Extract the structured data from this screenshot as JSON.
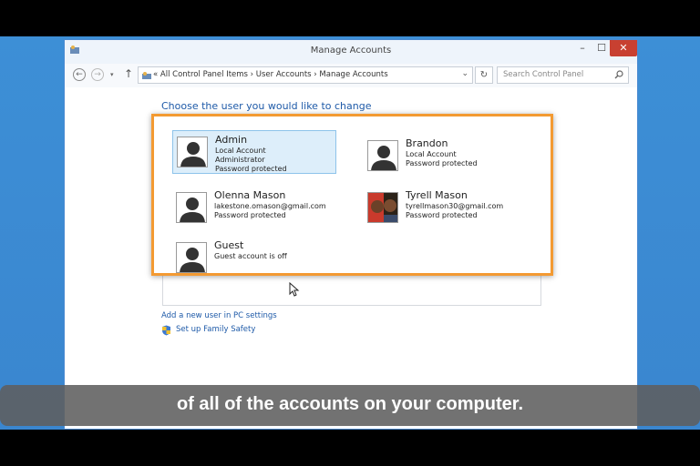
{
  "window": {
    "title": "Manage Accounts",
    "min_label": "–",
    "max_label": "☐",
    "close_label": "✕"
  },
  "nav": {
    "back_label": "←",
    "forward_label": "→",
    "recent_label": "▾",
    "up_label": "↑",
    "address": "« All Control Panel Items  ›  User Accounts  ›  Manage Accounts",
    "address_dropdown_label": "⌄",
    "refresh_label": "↻",
    "search_placeholder": "Search Control Panel"
  },
  "main": {
    "heading": "Choose the user you would like to change",
    "accounts": [
      {
        "name": "Admin",
        "lines": [
          "Local Account",
          "Administrator",
          "Password protected"
        ],
        "selected": true,
        "photo": false
      },
      {
        "name": "Brandon",
        "lines": [
          "Local Account",
          "Password protected"
        ],
        "selected": false,
        "photo": false
      },
      {
        "name": "Olenna Mason",
        "lines": [
          "lakestone.omason@gmail.com",
          "Password protected"
        ],
        "selected": false,
        "photo": false
      },
      {
        "name": "Tyrell Mason",
        "lines": [
          "tyrellmason30@gmail.com",
          "Password protected"
        ],
        "selected": false,
        "photo": true
      },
      {
        "name": "Guest",
        "lines": [
          "Guest account is off"
        ],
        "selected": false,
        "photo": false
      }
    ],
    "links": {
      "add_user": "Add a new user in PC settings",
      "family_safety": "Set up Family Safety"
    }
  },
  "caption": "of all of the accounts on your computer.",
  "colors": {
    "highlight_border": "#f39a32",
    "link": "#1e5aa8",
    "selected_bg": "#ddeefa",
    "close_button": "#c84031"
  }
}
